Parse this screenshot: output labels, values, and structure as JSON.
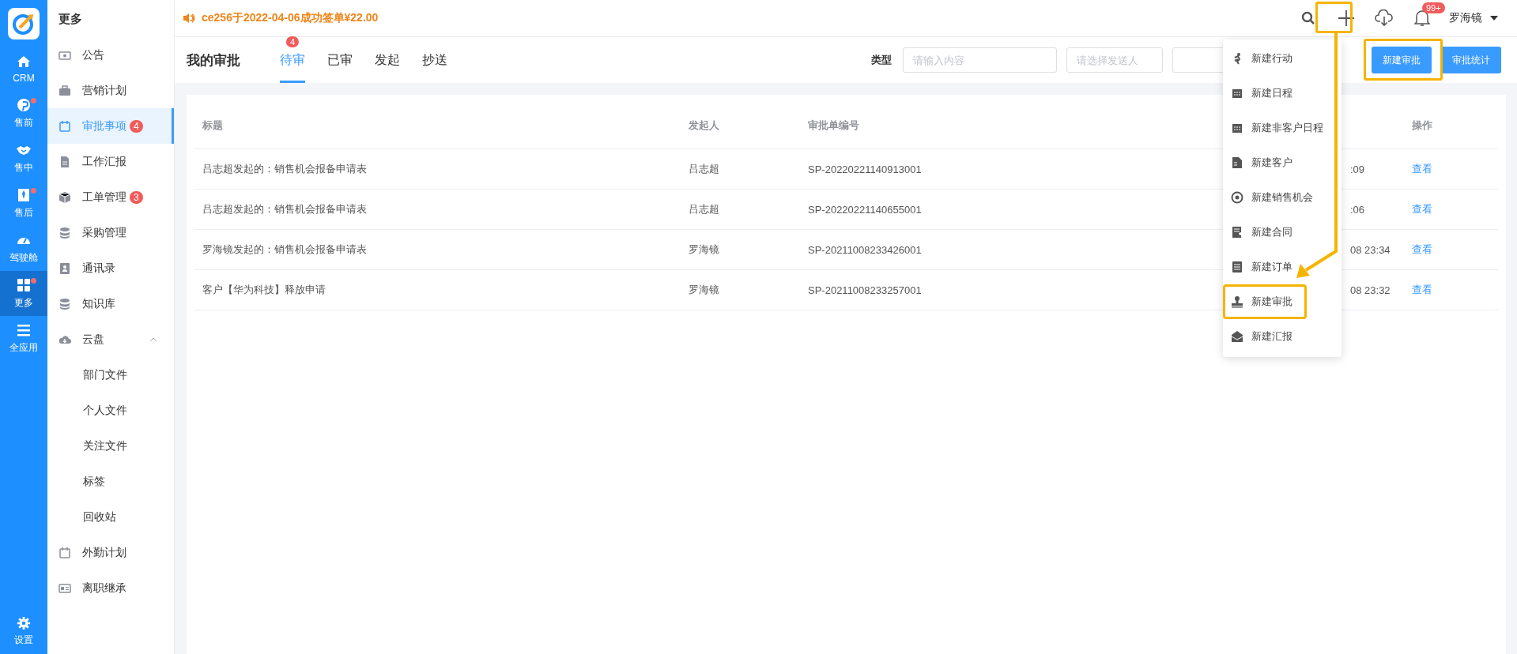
{
  "rail": {
    "items": [
      {
        "label": "CRM",
        "selected": false,
        "dot": false
      },
      {
        "label": "售前",
        "selected": false,
        "dot": true
      },
      {
        "label": "售中",
        "selected": false,
        "dot": false
      },
      {
        "label": "售后",
        "selected": false,
        "dot": true
      },
      {
        "label": "驾驶舱",
        "selected": false,
        "dot": false
      },
      {
        "label": "更多",
        "selected": true,
        "dot": true
      },
      {
        "label": "全应用",
        "selected": false,
        "dot": false
      }
    ],
    "footer": {
      "label": "设置"
    }
  },
  "sidebar": {
    "title": "更多",
    "items": [
      {
        "label": "公告",
        "selected": false
      },
      {
        "label": "营销计划",
        "selected": false
      },
      {
        "label": "审批事项",
        "selected": true,
        "badge": "4"
      },
      {
        "label": "工作汇报",
        "selected": false
      },
      {
        "label": "工单管理",
        "selected": false,
        "badge": "3"
      },
      {
        "label": "采购管理",
        "selected": false
      },
      {
        "label": "通讯录",
        "selected": false
      },
      {
        "label": "知识库",
        "selected": false
      },
      {
        "label": "云盘",
        "selected": false,
        "expanded": true,
        "children": [
          {
            "label": "部门文件",
            "selected": false
          },
          {
            "label": "个人文件",
            "selected": false
          },
          {
            "label": "关注文件",
            "selected": false
          },
          {
            "label": "标签",
            "selected": false
          },
          {
            "label": "回收站",
            "selected": false
          }
        ]
      },
      {
        "label": "外勤计划",
        "selected": false
      },
      {
        "label": "离职继承",
        "selected": false
      }
    ]
  },
  "header": {
    "notice": "ce256于2022-04-06成功签单¥22.00",
    "notifications_badge": "99+",
    "user": "罗海镜"
  },
  "page": {
    "title": "我的审批",
    "tabs": [
      {
        "label": "待审",
        "selected": true,
        "badge": "4"
      },
      {
        "label": "已审",
        "selected": false
      },
      {
        "label": "发起",
        "selected": false
      },
      {
        "label": "抄送",
        "selected": false
      }
    ],
    "filter": {
      "label": "类型",
      "fields": [
        {
          "placeholder": "请输入内容"
        },
        {
          "placeholder": "请选择发送人"
        }
      ]
    },
    "buttons": [
      "新建审批",
      "审批统计"
    ]
  },
  "table": {
    "columns": [
      "标题",
      "发起人",
      "审批单编号",
      "操作"
    ],
    "rows": [
      {
        "title": "吕志超发起的：销售机会报备申请表",
        "initiator": "吕志超",
        "number": "SP-20220221140913001",
        "column_4": ":09",
        "action": "查看"
      },
      {
        "title": "吕志超发起的：销售机会报备申请表",
        "initiator": "吕志超",
        "number": "SP-20220221140655001",
        "column_4": ":06",
        "action": "查看"
      },
      {
        "title": "罗海镜发起的：销售机会报备申请表",
        "initiator": "罗海镜",
        "number": "SP-20211008233426001",
        "column_4": "08 23:34",
        "action": "查看"
      },
      {
        "title": "客户【华为科技】释放申请",
        "initiator": "罗海镜",
        "number": "SP-20211008233257001",
        "column_4": "08 23:32",
        "action": "查看"
      }
    ]
  },
  "create_menu": {
    "items": [
      {
        "label": "新建行动",
        "highlighted": false
      },
      {
        "label": "新建日程",
        "highlighted": false
      },
      {
        "label": "新建非客户日程",
        "highlighted": false
      },
      {
        "label": "新建客户",
        "highlighted": false
      },
      {
        "label": "新建销售机会",
        "highlighted": false
      },
      {
        "label": "新建合同",
        "highlighted": false
      },
      {
        "label": "新建订单",
        "highlighted": false
      },
      {
        "label": "新建审批",
        "highlighted": true
      },
      {
        "label": "新建汇报",
        "highlighted": false
      }
    ]
  }
}
